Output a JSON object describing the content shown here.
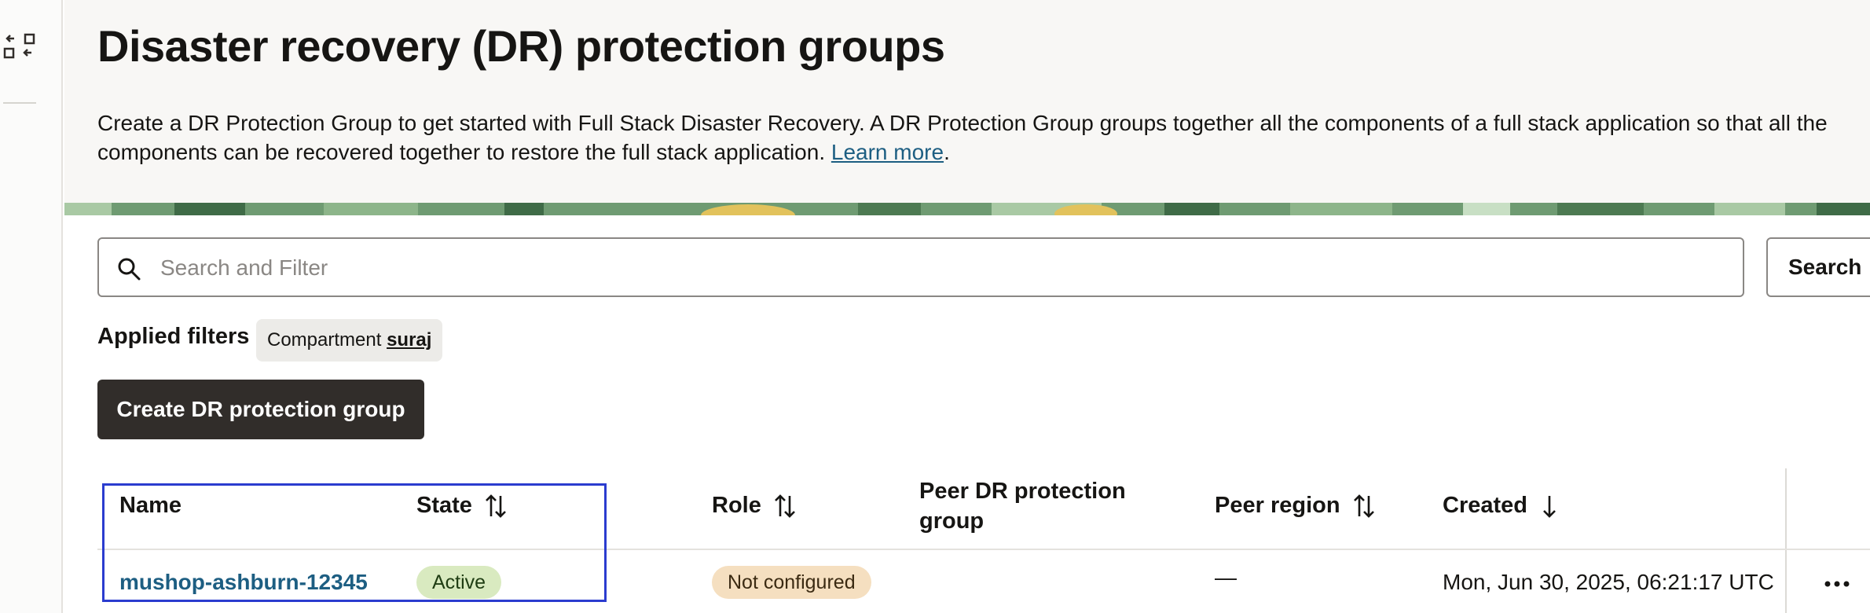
{
  "rail": {
    "icon_name": "swap-panels-icon"
  },
  "header": {
    "title": "Disaster recovery (DR) protection groups",
    "description": "Create a DR Protection Group to get started with Full Stack Disaster Recovery. A DR Protection Group groups together all the components of a full stack application so that all the components can be recovered together to restore the full stack application.",
    "learn_more": "Learn more",
    "trailing_period": "."
  },
  "search": {
    "placeholder": "Search and Filter",
    "button_label": "Search",
    "icon_name": "search-icon"
  },
  "filters": {
    "label": "Applied filters",
    "chips": [
      {
        "key": "Compartment",
        "value": "suraj"
      }
    ]
  },
  "actions": {
    "create_label": "Create DR protection group"
  },
  "table": {
    "columns": [
      {
        "label": "Name",
        "sort": "none"
      },
      {
        "label": "State",
        "sort": "sortable"
      },
      {
        "label": "Role",
        "sort": "sortable"
      },
      {
        "label": "Peer DR protection group",
        "sort": "none"
      },
      {
        "label": "Peer region",
        "sort": "sortable"
      },
      {
        "label": "Created",
        "sort": "descending"
      }
    ],
    "rows": [
      {
        "name": "mushop-ashburn-12345",
        "state": "Active",
        "role": "Not configured",
        "peer_group": "",
        "peer_region": "—",
        "created": "Mon, Jun 30, 2025, 06:21:17 UTC",
        "more_icon": "ellipsis-icon"
      }
    ]
  },
  "colors": {
    "link": "#1d5e82",
    "primary_button": "#312d2a",
    "active_badge": "#d9eac0",
    "role_badge": "#f5dfc0",
    "highlight": "#2b3ccf",
    "header_bg": "#f8f7f5"
  }
}
